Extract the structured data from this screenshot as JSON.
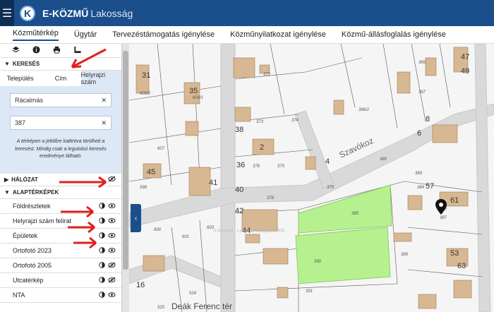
{
  "app": {
    "logo_letter": "K",
    "brand": "E-KÖZMŰ",
    "brand_sub": "Lakosság"
  },
  "menu": [
    {
      "label": "Közműtérkép"
    },
    {
      "label": "Ügytár"
    },
    {
      "label": "Tervezéstámogatás igénylése"
    },
    {
      "label": "Közműnyilatkozat igénylése"
    },
    {
      "label": "Közmű-állásfoglalás igénylése"
    }
  ],
  "tools": [
    "layers-icon",
    "info-icon",
    "print-icon",
    "measure-icon"
  ],
  "search": {
    "title": "KERESÉS",
    "tabs": [
      "Település",
      "Cím",
      "Helyrajzi szám"
    ],
    "town_value": "Rácalmás",
    "parcel_value": "387",
    "hint": "A térképen a jelölőre kattintva törölheti a keresést. Mindig csak a legutolsó keresés eredménye látható."
  },
  "network": {
    "title": "HÁLÓZAT"
  },
  "basemaps": {
    "title": "ALAPTÉRKÉPEK",
    "layers": [
      {
        "label": "Földrészletek",
        "visible": true
      },
      {
        "label": "Helyrajzi szám felirat",
        "visible": true
      },
      {
        "label": "Épületek",
        "visible": true
      },
      {
        "label": "Ortofotó 2023",
        "visible": true
      },
      {
        "label": "Ortofotó 2005",
        "visible": false
      },
      {
        "label": "Utcatérkép",
        "visible": false
      },
      {
        "label": "NTA",
        "visible": true
      }
    ]
  },
  "map": {
    "square_label": "Deák Ferenc tér",
    "street_label": "Szavókoz",
    "watermark": "e-közmű · Lechner Nonprofit Kft.",
    "house_numbers": [
      "31",
      "35",
      "38",
      "36",
      "40",
      "42",
      "44",
      "45",
      "41",
      "47",
      "49",
      "57",
      "61",
      "53",
      "63",
      "2",
      "4",
      "6",
      "8",
      "16"
    ],
    "parcel_numbers": [
      "372",
      "373",
      "374",
      "375",
      "376",
      "378",
      "379",
      "380",
      "383",
      "384",
      "385",
      "386",
      "387",
      "389",
      "390",
      "391",
      "365",
      "367",
      "368/2",
      "599",
      "600",
      "601",
      "603",
      "607",
      "524",
      "525",
      "609/2",
      "609/1"
    ],
    "highlight_color": "#b7f08f",
    "marker_color": "#111111"
  }
}
